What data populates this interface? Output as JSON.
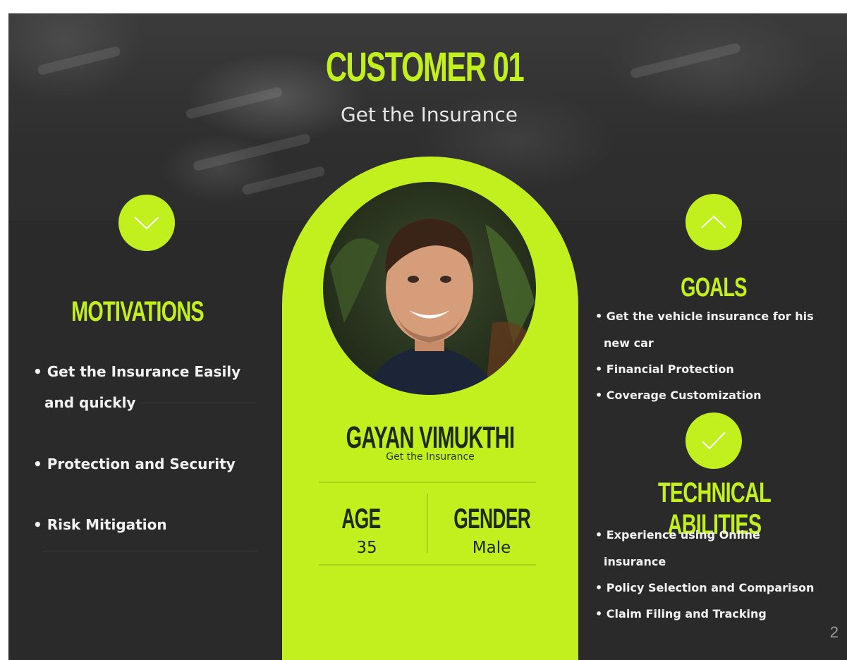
{
  "header": {
    "title": "CUSTOMER 01",
    "subtitle": "Get the Insurance"
  },
  "motivations": {
    "heading": "MOTIVATIONS",
    "items": [
      "• Get the Insurance Easily",
      "and quickly",
      "• Protection and Security",
      "• Risk Mitigation"
    ]
  },
  "profile": {
    "name": "GAYAN VIMUKTHI",
    "role": "Get the Insurance",
    "age_label": "AGE",
    "age_value": "35",
    "gender_label": "GENDER",
    "gender_value": "Male"
  },
  "goals": {
    "heading": "GOALS",
    "items": [
      "• Get the vehicle insurance for his",
      "new car",
      "• Financial Protection",
      "• Coverage Customization"
    ]
  },
  "technical": {
    "heading": "TECHNICAL ABILITIES",
    "items": [
      "• Experience using Online",
      "insurance",
      "• Policy Selection and Comparison",
      "• Claim Filing and Tracking"
    ]
  },
  "page_number": "2",
  "icons": {
    "motivations": "chevron-down-icon",
    "goals": "chevron-up-icon",
    "technical": "checkmark-icon",
    "photo": "person-photo"
  },
  "colors": {
    "accent": "#c2f01e",
    "background": "#2a2a2a",
    "text": "#f2f2f2"
  }
}
